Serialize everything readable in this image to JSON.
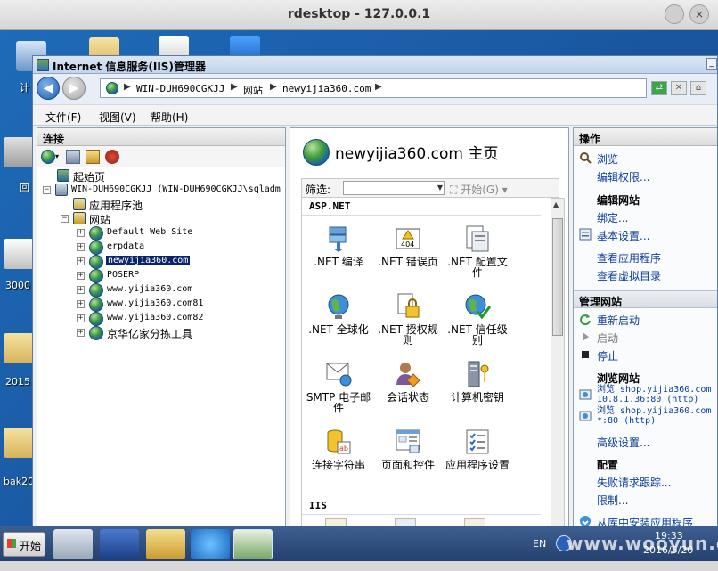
{
  "window": {
    "title": "rdesktop - 127.0.0.1"
  },
  "desktop": {
    "labels": [
      "计",
      "回",
      "3000",
      "2015",
      "bak20"
    ]
  },
  "iis": {
    "title": "Internet 信息服务(IIS)管理器",
    "address": [
      "WIN-DUH690CGKJJ",
      "网站",
      "newyijia360.com"
    ],
    "menu": [
      "文件(F)",
      "视图(V)",
      "帮助(H)"
    ]
  },
  "connections": {
    "header": "连接",
    "tree": [
      {
        "label": "起始页"
      },
      {
        "label": "WIN-DUH690CGKJJ (WIN-DUH690CGKJJ\\sqladm"
      },
      {
        "label": "应用程序池"
      },
      {
        "label": "网站"
      },
      {
        "label": "Default Web Site"
      },
      {
        "label": "erpdata"
      },
      {
        "label": "newyijia360.com"
      },
      {
        "label": "POSERP"
      },
      {
        "label": "www.yijia360.com"
      },
      {
        "label": "www.yijia360.com81"
      },
      {
        "label": "www.yijia360.com82"
      },
      {
        "label": "京华亿家分拣工具"
      }
    ]
  },
  "center": {
    "title": "newyijia360.com 主页",
    "filter_label": "筛选:",
    "start_label": "开始(G)",
    "groups": [
      {
        "name": "ASP.NET",
        "features": [
          {
            "label": ".NET 编译",
            "icon": "compile-icon"
          },
          {
            "label": ".NET 错误页",
            "icon": "error-page-icon",
            "badge": "404"
          },
          {
            "label": ".NET 配置文件",
            "icon": "profile-icon"
          },
          {
            "label": ".NET 全球化",
            "icon": "globalization-icon"
          },
          {
            "label": ".NET 授权规则",
            "icon": "authorization-icon"
          },
          {
            "label": ".NET 信任级别",
            "icon": "trust-level-icon"
          },
          {
            "label": "SMTP 电子邮件",
            "icon": "smtp-icon"
          },
          {
            "label": "会话状态",
            "icon": "session-state-icon"
          },
          {
            "label": "计算机密钥",
            "icon": "machine-key-icon"
          },
          {
            "label": "连接字符串",
            "icon": "connection-string-icon"
          },
          {
            "label": "页面和控件",
            "icon": "pages-controls-icon"
          },
          {
            "label": "应用程序设置",
            "icon": "app-settings-icon"
          }
        ]
      },
      {
        "name": "IIS",
        "features": []
      }
    ]
  },
  "actions": {
    "header": "操作",
    "top": [
      {
        "label": "浏览"
      },
      {
        "label": "编辑权限..."
      }
    ],
    "edit_site": {
      "title": "编辑网站",
      "items": [
        {
          "label": "绑定..."
        },
        {
          "label": "基本设置..."
        },
        {
          "label": "查看应用程序"
        },
        {
          "label": "查看虚拟目录"
        }
      ]
    },
    "manage_site": {
      "title": "管理网站",
      "items": [
        {
          "label": "重新启动"
        },
        {
          "label": "启动"
        },
        {
          "label": "停止"
        }
      ]
    },
    "browse_site": {
      "title": "浏览网站",
      "items": [
        {
          "line1": "浏览 shop.yijia360.com",
          "line2": "10.8.1.36:80 (http)"
        },
        {
          "line1": "浏览 shop.yijia360.com",
          "line2": "*:80 (http)"
        }
      ],
      "advanced": "高级设置..."
    },
    "config": {
      "title": "配置",
      "items": [
        {
          "label": "失败请求跟踪..."
        },
        {
          "label": "限制..."
        }
      ]
    },
    "install_gallery": "从库中安装应用程序"
  },
  "taskbar": {
    "start": "开始",
    "lang": "EN",
    "time": "19:33",
    "date": "2016/5/20"
  },
  "watermark": "www.wooyun.org"
}
